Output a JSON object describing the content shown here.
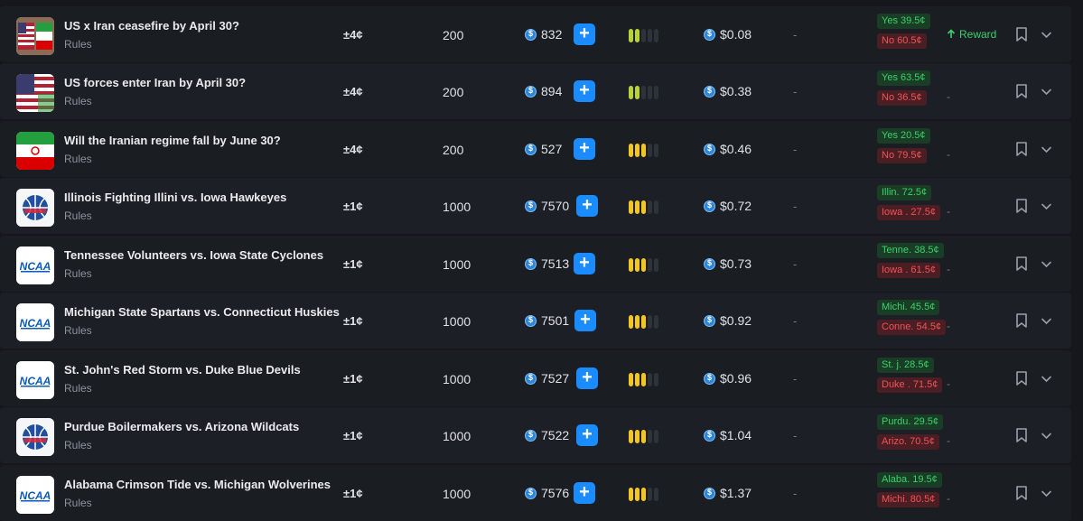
{
  "rows": [
    {
      "title": "US x Iran ceasefire by April 30?",
      "rules": "Rules",
      "icon": "us-iran-flags-icon",
      "spread": "±4¢",
      "size": "200",
      "volume": "832",
      "level": 2,
      "level_color": "green",
      "price": "$0.08",
      "dash": "-",
      "yes": "Yes 39.5¢",
      "no": "No 60.5¢",
      "extra": "Reward",
      "extra_type": "reward"
    },
    {
      "title": "US forces enter Iran by April 30?",
      "rules": "Rules",
      "icon": "us-flag-icon",
      "spread": "±4¢",
      "size": "200",
      "volume": "894",
      "level": 2,
      "level_color": "green",
      "price": "$0.38",
      "dash": "-",
      "yes": "Yes 63.5¢",
      "no": "No 36.5¢",
      "extra": "-",
      "extra_type": "dash"
    },
    {
      "title": "Will the Iranian regime fall by June 30?",
      "rules": "Rules",
      "icon": "iran-flag-icon",
      "spread": "±4¢",
      "size": "200",
      "volume": "527",
      "level": 3,
      "level_color": "yellow",
      "price": "$0.46",
      "dash": "-",
      "yes": "Yes 20.5¢",
      "no": "No 79.5¢",
      "extra": "-",
      "extra_type": "dash"
    },
    {
      "title": "Illinois Fighting Illini vs. Iowa Hawkeyes",
      "rules": "Rules",
      "icon": "basketball-icon",
      "spread": "±1¢",
      "size": "1000",
      "volume": "7570",
      "level": 3,
      "level_color": "yellow",
      "price": "$0.72",
      "dash": "-",
      "yes": "Illin. 72.5¢",
      "no": "Iowa . 27.5¢",
      "extra": "-",
      "extra_type": "dash"
    },
    {
      "title": "Tennessee Volunteers vs. Iowa State Cyclones",
      "rules": "Rules",
      "icon": "ncaa-logo-icon",
      "spread": "±1¢",
      "size": "1000",
      "volume": "7513",
      "level": 3,
      "level_color": "yellow",
      "price": "$0.73",
      "dash": "-",
      "yes": "Tenne. 38.5¢",
      "no": "Iowa . 61.5¢",
      "extra": "-",
      "extra_type": "dash"
    },
    {
      "title": "Michigan State Spartans vs. Connecticut Huskies",
      "rules": "Rules",
      "icon": "ncaa-logo-icon",
      "spread": "±1¢",
      "size": "1000",
      "volume": "7501",
      "level": 3,
      "level_color": "yellow",
      "price": "$0.92",
      "dash": "-",
      "yes": "Michi. 45.5¢",
      "no": "Conne. 54.5¢",
      "extra": "-",
      "extra_type": "dash"
    },
    {
      "title": "St. John's Red Storm vs. Duke Blue Devils",
      "rules": "Rules",
      "icon": "ncaa-logo-icon",
      "spread": "±1¢",
      "size": "1000",
      "volume": "7527",
      "level": 3,
      "level_color": "yellow",
      "price": "$0.96",
      "dash": "-",
      "yes": "St. j. 28.5¢",
      "no": "Duke . 71.5¢",
      "extra": "-",
      "extra_type": "dash"
    },
    {
      "title": "Purdue Boilermakers vs. Arizona Wildcats",
      "rules": "Rules",
      "icon": "basketball-icon",
      "spread": "±1¢",
      "size": "1000",
      "volume": "7522",
      "level": 3,
      "level_color": "yellow",
      "price": "$1.04",
      "dash": "-",
      "yes": "Purdu. 29.5¢",
      "no": "Arizo. 70.5¢",
      "extra": "-",
      "extra_type": "dash"
    },
    {
      "title": "Alabama Crimson Tide vs. Michigan Wolverines",
      "rules": "Rules",
      "icon": "ncaa-logo-icon",
      "spread": "±1¢",
      "size": "1000",
      "volume": "7576",
      "level": 3,
      "level_color": "yellow",
      "price": "$1.37",
      "dash": "-",
      "yes": "Alaba. 19.5¢",
      "no": "Michi. 80.5¢",
      "extra": "-",
      "extra_type": "dash"
    }
  ],
  "colors": {
    "accent": "#1a8cff",
    "yes": "#3dd16d",
    "no": "#f0535a",
    "level_green": "#b7d334",
    "level_yellow": "#f3c623"
  }
}
